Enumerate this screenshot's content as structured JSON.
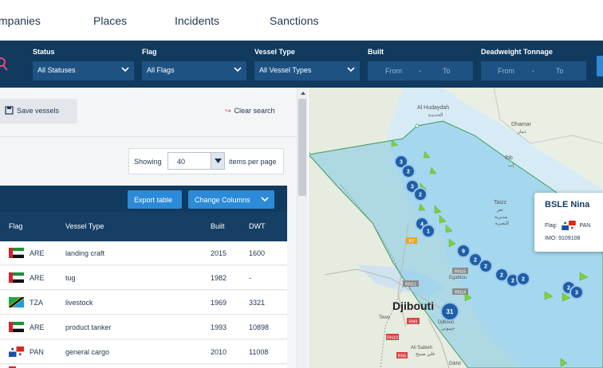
{
  "nav": {
    "items": [
      "mpanies",
      "Places",
      "Incidents",
      "Sanctions"
    ]
  },
  "filters": {
    "status": {
      "label": "Status",
      "value": "All Statuses"
    },
    "flag": {
      "label": "Flag",
      "value": "All Flags"
    },
    "vessel_type": {
      "label": "Vessel Type",
      "value": "All Vessel Types"
    },
    "built": {
      "label": "Built",
      "from": "From",
      "to": "To"
    },
    "deadweight": {
      "label": "Deadweight Tonnage",
      "from": "From",
      "to": "To"
    }
  },
  "actions": {
    "save_vessels": "Save vessels",
    "clear_search": "Clear search"
  },
  "pagination": {
    "showing_label": "Showing",
    "per_page_value": "40",
    "per_page_suffix": "items per page"
  },
  "table_toolbar": {
    "export": "Export table",
    "change_columns": "Change Columns"
  },
  "table": {
    "columns": [
      "Flag",
      "Vessel Type",
      "Built",
      "DWT"
    ],
    "rows": [
      {
        "flag_icon": "uae-flag-icon",
        "flag": "ARE",
        "type": "landing craft",
        "built": "2015",
        "dwt": "1600"
      },
      {
        "flag_icon": "uae-flag-icon",
        "flag": "ARE",
        "type": "tug",
        "built": "1982",
        "dwt": "-"
      },
      {
        "flag_icon": "tanzania-flag-icon",
        "flag": "TZA",
        "type": "livestock",
        "built": "1969",
        "dwt": "3321"
      },
      {
        "flag_icon": "uae-flag-icon",
        "flag": "ARE",
        "type": "product tanker",
        "built": "1993",
        "dwt": "10898"
      },
      {
        "flag_icon": "panama-flag-icon",
        "flag": "PAN",
        "type": "general cargo",
        "built": "2010",
        "dwt": "11008"
      }
    ]
  },
  "map": {
    "labels": {
      "hudaydah": "Al Hudaydah",
      "hudaydah_ar": "الحديدة",
      "dhamar": "Dhamar",
      "dhamar_ar": "ذمار",
      "ibb": "Ibb",
      "ibb_ar": "إب",
      "taizz": "Taizz",
      "taizz_ar": "تعز",
      "basra": "مديرية",
      "basra2": "البصرة",
      "djibouti": "Djibouti",
      "djibouti_city": "Djibouti",
      "djibouti_city_ar": "جيبوتي",
      "egahlou": "Egahlou",
      "tewo": "Tewo",
      "ali_sabieh": "Ali Sabieh",
      "ali_sabieh_ar": "علي صبيح",
      "dikhil": "Dikhil"
    },
    "road_badges": [
      "P7",
      "RN11",
      "RN14",
      "RN9",
      "RN15",
      "RN10",
      "RN5"
    ],
    "clusters": [
      "3",
      "2",
      "3",
      "2",
      "4",
      "1",
      "9",
      "2",
      "2",
      "2",
      "2",
      "2",
      "2",
      "2",
      "3",
      "31"
    ],
    "popup": {
      "title": "BSLE Nina",
      "flag_label": "Flag:",
      "flag_value": "PAN",
      "imo_label": "IMO:",
      "imo_value": "9109108"
    }
  },
  "colors": {
    "navy": "#113a5f",
    "field": "#1d5283",
    "accent": "#2b8bd8",
    "cluster": "#1f5fa8",
    "vessel": "#7fd13b",
    "pink": "#e4477e"
  }
}
